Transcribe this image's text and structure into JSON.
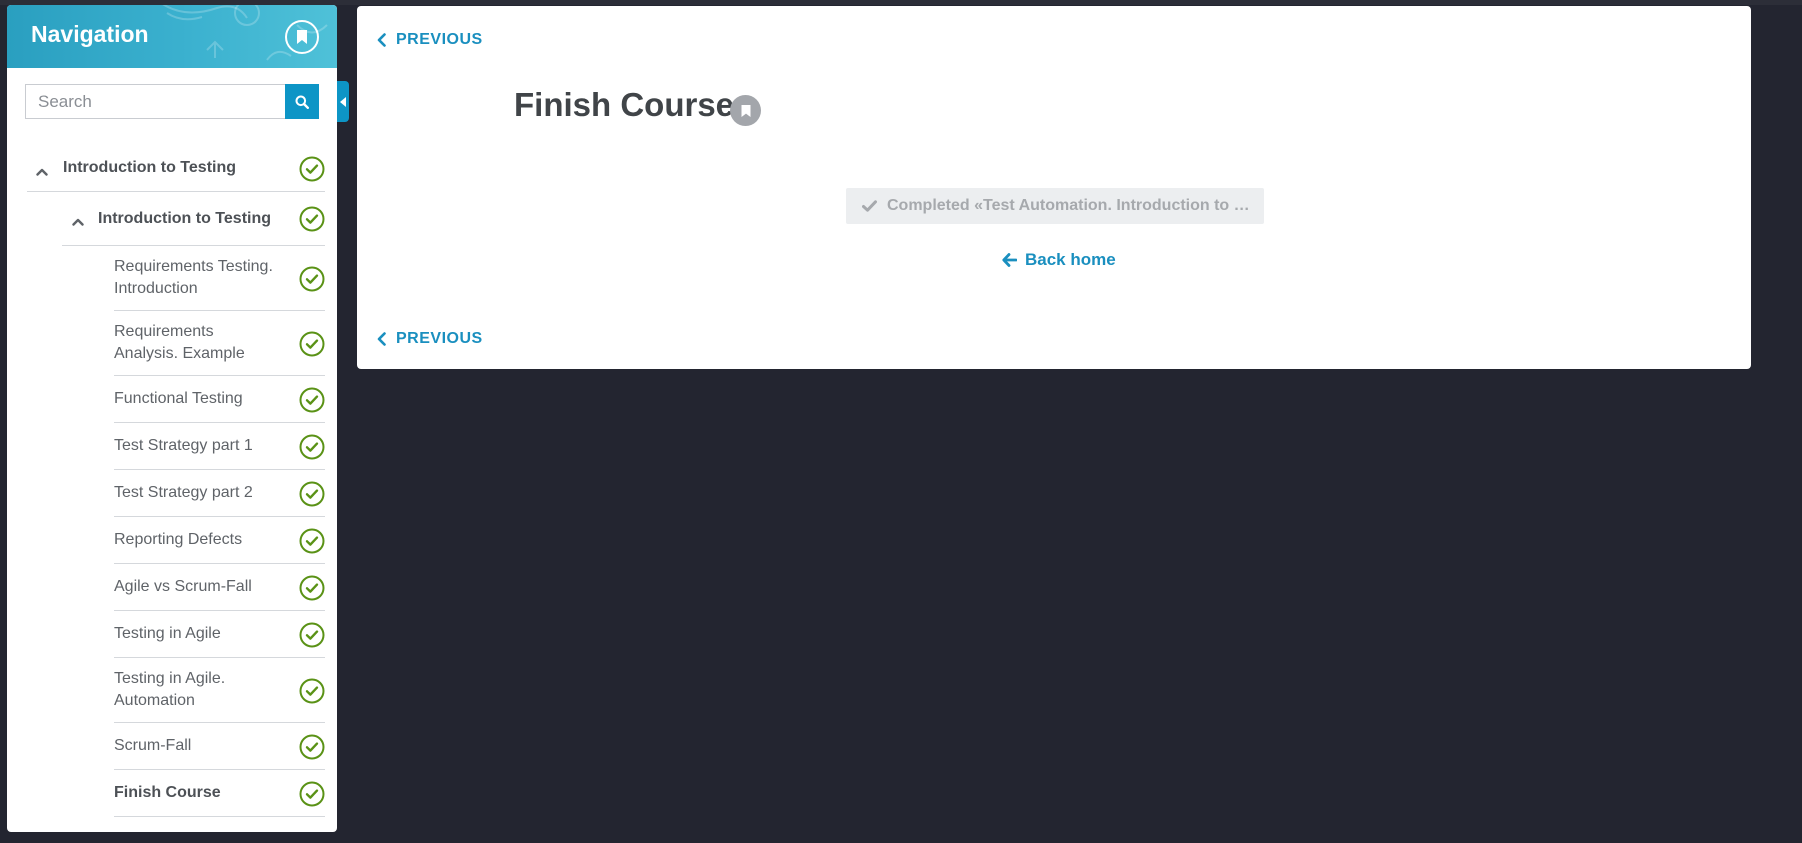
{
  "sidebar": {
    "title": "Navigation",
    "search": {
      "placeholder": "Search",
      "value": ""
    },
    "items": [
      {
        "label": "Introduction to Testing",
        "level": 0,
        "expanded": true,
        "completed": true
      },
      {
        "label": "Introduction to Testing",
        "level": 1,
        "expanded": true,
        "completed": true
      },
      {
        "label": "Requirements Testing. Introduction",
        "level": 2,
        "completed": true
      },
      {
        "label": "Requirements Analysis. Example",
        "level": 2,
        "completed": true
      },
      {
        "label": "Functional Testing",
        "level": 2,
        "completed": true
      },
      {
        "label": "Test Strategy part 1",
        "level": 2,
        "completed": true
      },
      {
        "label": "Test Strategy part 2",
        "level": 2,
        "completed": true
      },
      {
        "label": "Reporting Defects",
        "level": 2,
        "completed": true
      },
      {
        "label": "Agile vs Scrum-Fall",
        "level": 2,
        "completed": true
      },
      {
        "label": "Testing in Agile",
        "level": 2,
        "completed": true
      },
      {
        "label": "Testing in Agile. Automation",
        "level": 2,
        "completed": true
      },
      {
        "label": "Scrum-Fall",
        "level": 2,
        "completed": true
      },
      {
        "label": "Finish Course",
        "level": 2,
        "completed": true,
        "current": true
      }
    ]
  },
  "main": {
    "prev_top_label": "PREVIOUS",
    "prev_bottom_label": "PREVIOUS",
    "title": "Finish Course",
    "completed_label": "Completed «Test Automation. Introduction to …",
    "back_home_label": "Back home"
  },
  "colors": {
    "accent": "#0d95c6",
    "check_green": "#5a9216",
    "background": "#232530",
    "header_teal": "#3bb1cf"
  },
  "icons": {
    "nav_bookmark": "bookmark-icon",
    "search": "search-icon",
    "chevron_up": "chevron-up-icon",
    "check_circle": "check-circle-icon",
    "chevron_left": "chevron-left-icon",
    "arrow_left": "arrow-left-icon",
    "check": "check-icon",
    "collapse": "caret-left-icon"
  }
}
